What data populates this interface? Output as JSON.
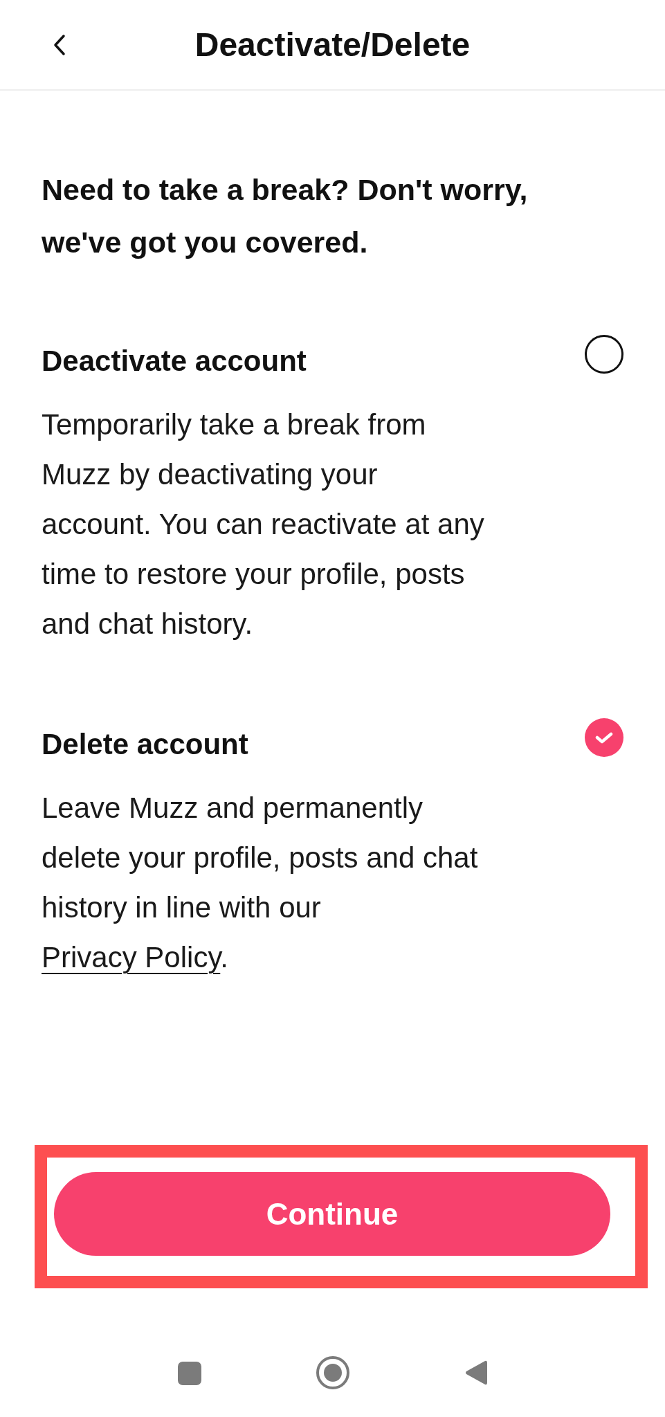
{
  "header": {
    "title": "Deactivate/Delete"
  },
  "intro": "Need to take a break? Don't worry, we've got you covered.",
  "options": [
    {
      "title": "Deactivate account",
      "description": "Temporarily take a break from Muzz by deactivating your account. You can reactivate at any time to restore your profile, posts and chat history.",
      "selected": false
    },
    {
      "title": "Delete account",
      "description": "Leave Muzz and permanently delete your profile, posts and chat history in line with our",
      "link": "Privacy Policy",
      "description_end": ".",
      "selected": true
    }
  ],
  "continue_button": {
    "label": "Continue"
  }
}
